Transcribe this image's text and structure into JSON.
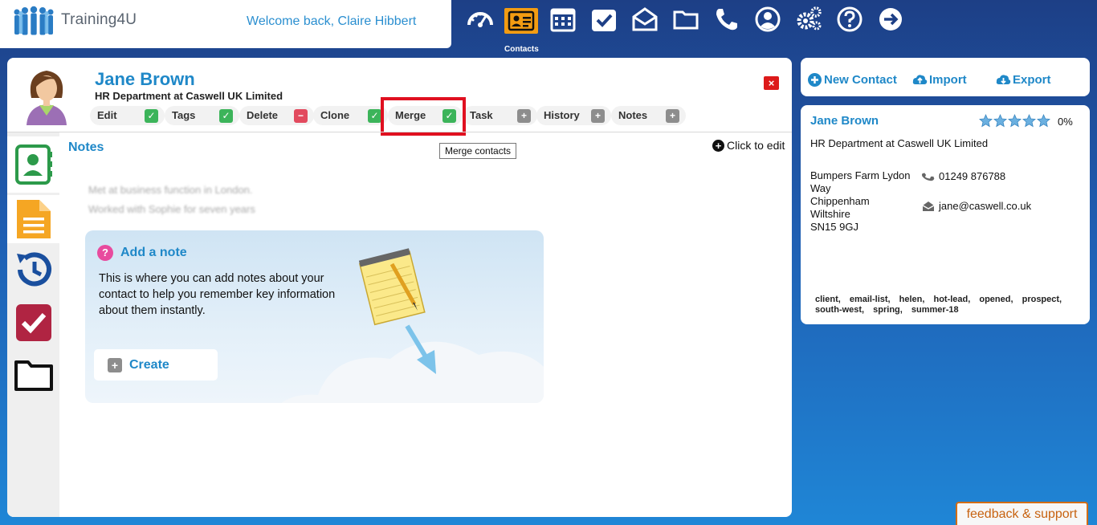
{
  "app": {
    "logo_text": "Training4U",
    "welcome": "Welcome back, Claire Hibbert"
  },
  "topnav": {
    "items": [
      {
        "icon": "dashboard-icon"
      },
      {
        "icon": "contacts-icon",
        "active": true
      },
      {
        "icon": "calendar-icon"
      },
      {
        "icon": "tasks-icon"
      },
      {
        "icon": "mail-icon"
      },
      {
        "icon": "folder-icon"
      },
      {
        "icon": "phone-icon"
      },
      {
        "icon": "user-icon"
      },
      {
        "icon": "settings-icon"
      },
      {
        "icon": "help-icon"
      },
      {
        "icon": "logout-icon"
      }
    ],
    "active_label": "Contacts"
  },
  "contact": {
    "name": "Jane Brown",
    "subtitle": "HR Department at Caswell UK Limited",
    "close_label": "×",
    "actions": [
      {
        "label": "Edit",
        "icon": "check-icon",
        "color": "#3cb45a"
      },
      {
        "label": "Tags",
        "icon": "check-icon",
        "color": "#3cb45a"
      },
      {
        "label": "Delete",
        "icon": "minus-icon",
        "color": "#e24a5e"
      },
      {
        "label": "Clone",
        "icon": "check-icon",
        "color": "#3cb45a"
      },
      {
        "label": "Merge",
        "icon": "check-icon",
        "color": "#3cb45a"
      },
      {
        "label": "Task",
        "icon": "plus-icon",
        "color": "#8d8d8d"
      },
      {
        "label": "History",
        "icon": "plus-icon",
        "color": "#8d8d8d"
      },
      {
        "label": "Notes",
        "icon": "plus-icon",
        "color": "#8d8d8d"
      }
    ],
    "tooltip": "Merge contacts"
  },
  "notes": {
    "title": "Notes",
    "click_to_edit": "Click to edit",
    "lines": [
      "Met at business function in London.",
      "Worked with Sophie for seven years"
    ],
    "card": {
      "title": "Add a note",
      "text": "This is where you can add notes about your contact to help you remember key information about them instantly.",
      "create_label": "Create"
    }
  },
  "right": {
    "new_contact": "New Contact",
    "import": "Import",
    "export": "Export",
    "summary": {
      "name": "Jane Brown",
      "rating_percent": "0%",
      "stars": 5,
      "subtitle": "HR Department at Caswell UK Limited",
      "address": [
        "Bumpers Farm Lydon Way",
        "Chippenham",
        "Wiltshire",
        "SN15 9GJ"
      ],
      "phone": "01249 876788",
      "email": "jane@caswell.co.uk",
      "tags": "client, email-list, helen, hot-lead, opened, prospect, south-west, spring, summer-18"
    }
  },
  "feedback": "feedback & support",
  "colors": {
    "brand_blue": "#1f88c8",
    "active_nav": "#f39c12",
    "highlight": "#e01020"
  }
}
